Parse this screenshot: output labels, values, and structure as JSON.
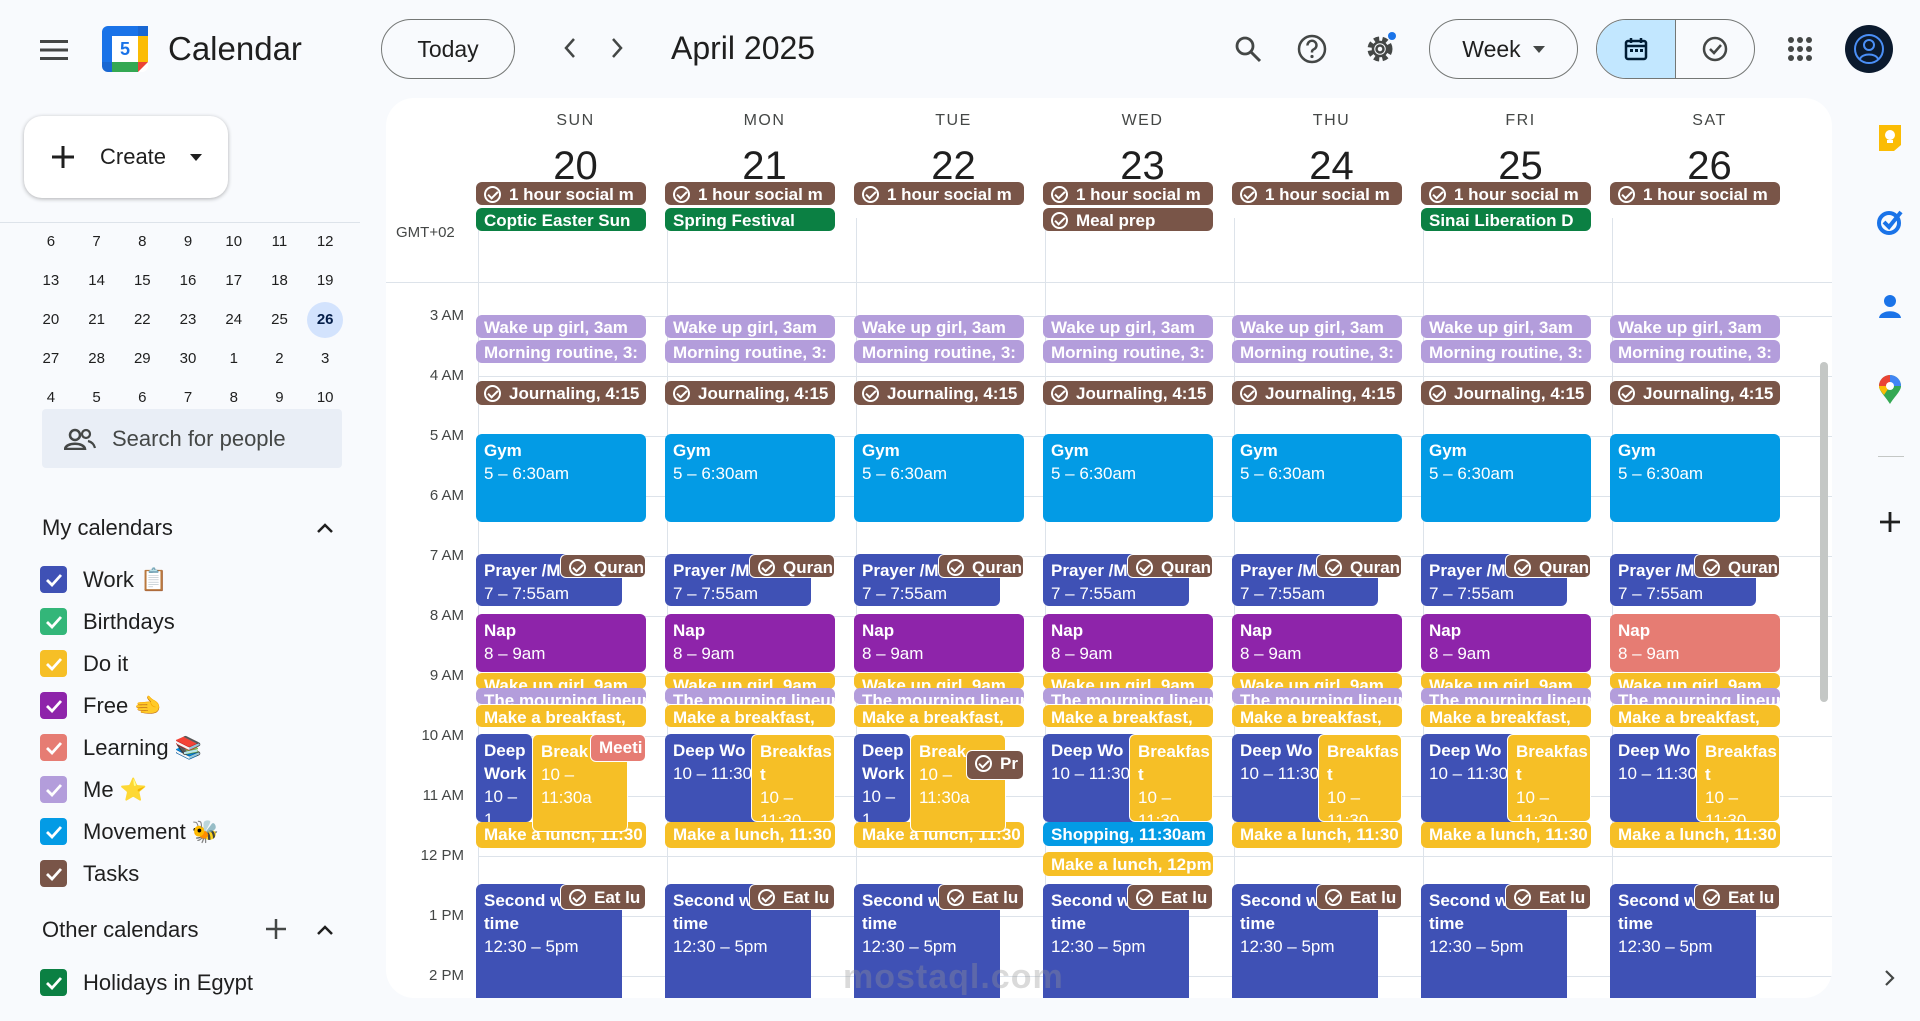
{
  "app": {
    "title": "Calendar",
    "logo_day": "5"
  },
  "header": {
    "today_label": "Today",
    "month_label": "April 2025",
    "view_label": "Week",
    "icons": [
      "menu-icon",
      "chevron-left-icon",
      "chevron-right-icon",
      "search-icon",
      "help-icon",
      "settings-icon",
      "calendar-view-icon",
      "tasks-view-icon",
      "apps-grid-icon",
      "account-icon"
    ]
  },
  "sidebar": {
    "create_label": "Create",
    "mini_calendar": [
      [
        "6",
        "7",
        "8",
        "9",
        "10",
        "11",
        "12"
      ],
      [
        "13",
        "14",
        "15",
        "16",
        "17",
        "18",
        "19"
      ],
      [
        "20",
        "21",
        "22",
        "23",
        "24",
        "25",
        "26"
      ],
      [
        "27",
        "28",
        "29",
        "30",
        "1",
        "2",
        "3"
      ],
      [
        "4",
        "5",
        "6",
        "7",
        "8",
        "9",
        "10"
      ]
    ],
    "mini_selected": "26",
    "search_people_placeholder": "Search for people",
    "my_calendars_title": "My calendars",
    "my_calendars": [
      {
        "label": "Work 📋",
        "color": "#3f51b5"
      },
      {
        "label": "Birthdays",
        "color": "#33b679"
      },
      {
        "label": "Do it",
        "color": "#f6bf26"
      },
      {
        "label": "Free 🫲",
        "color": "#8e24aa"
      },
      {
        "label": "Learning 📚",
        "color": "#e67c73"
      },
      {
        "label": "Me ⭐",
        "color": "#b39ddb"
      },
      {
        "label": "Movement 🐝",
        "color": "#039be5"
      },
      {
        "label": "Tasks",
        "color": "#795548"
      }
    ],
    "other_calendars_title": "Other calendars",
    "other_calendars": [
      {
        "label": "Holidays in Egypt",
        "color": "#0b8043"
      }
    ]
  },
  "week": {
    "timezone": "GMT+02",
    "days": [
      {
        "dow": "SUN",
        "num": "20"
      },
      {
        "dow": "MON",
        "num": "21"
      },
      {
        "dow": "TUE",
        "num": "22"
      },
      {
        "dow": "WED",
        "num": "23"
      },
      {
        "dow": "THU",
        "num": "24"
      },
      {
        "dow": "FRI",
        "num": "25"
      },
      {
        "dow": "SAT",
        "num": "26"
      }
    ],
    "hours": [
      "3 AM",
      "4 AM",
      "5 AM",
      "6 AM",
      "7 AM",
      "8 AM",
      "9 AM",
      "10 AM",
      "11 AM",
      "12 PM",
      "1 PM",
      "2 PM"
    ],
    "allday": [
      [
        {
          "t": "1 hour social m",
          "task": true,
          "c": "#795548"
        },
        {
          "t": "Coptic Easter Sun",
          "c": "#0b8043"
        }
      ],
      [
        {
          "t": "1 hour social m",
          "task": true,
          "c": "#795548"
        },
        {
          "t": "Spring Festival",
          "c": "#0b8043"
        }
      ],
      [
        {
          "t": "1 hour social m",
          "task": true,
          "c": "#795548"
        }
      ],
      [
        {
          "t": "1 hour social m",
          "task": true,
          "c": "#795548"
        },
        {
          "t": "Meal prep",
          "task": true,
          "c": "#795548"
        }
      ],
      [
        {
          "t": "1 hour social m",
          "task": true,
          "c": "#795548"
        }
      ],
      [
        {
          "t": "1 hour social m",
          "task": true,
          "c": "#795548"
        },
        {
          "t": "Sinai Liberation D",
          "c": "#0b8043"
        }
      ],
      [
        {
          "t": "1 hour social m",
          "task": true,
          "c": "#795548"
        }
      ]
    ],
    "common_events": {
      "wake": "Wake up girl, 3am",
      "morning": "Morning routine, 3:",
      "journal": "Journaling, 4:15",
      "gym_title": "Gym",
      "gym_time": "5 – 6:30am",
      "prayer_title": "Prayer /M",
      "prayer_time": "7 – 7:55am",
      "quran": "Quran",
      "nap_title": "Nap",
      "nap_time": "8 – 9am",
      "wake9": "Wake up girl, 9am",
      "lineup": "The mourning lineup",
      "breakfast_make": "Make a breakfast,",
      "deep_title": "Deep Wo",
      "deep_time": "10 – 11:30",
      "deep_title_split": "Deep Work",
      "deep_time_short": "10 – 1",
      "breakfast_title": "Breakfas t",
      "breakfast_time": "10 – 11:30",
      "breakfast_short": "Break",
      "breakfast_short_time": "10 – 11:30a",
      "meeting": "Meeti",
      "pr": "Pr",
      "lunch": "Make a lunch, 11:30",
      "shopping": "Shopping, 11:30am",
      "lunch12": "Make a lunch, 12pm",
      "second_title": "Second w",
      "second_sub": "time",
      "second_time": "12:30 – 5pm",
      "eat": "Eat lu"
    }
  },
  "colors": {
    "me": "#b39ddb",
    "tasks": "#795548",
    "movement": "#039be5",
    "work": "#3f51b5",
    "free": "#8e24aa",
    "doit": "#f6bf26",
    "learning": "#e67c73",
    "holidays": "#0b8043"
  },
  "watermark": "mostaql.com"
}
